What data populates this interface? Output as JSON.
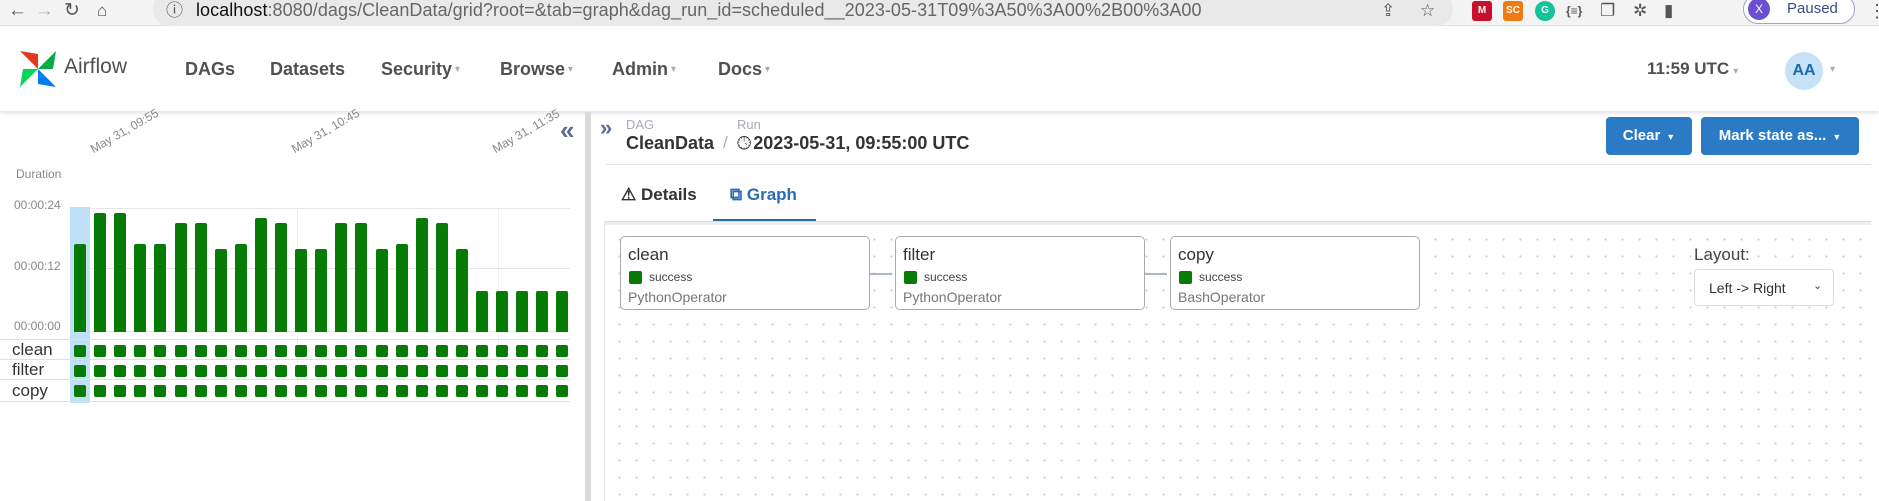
{
  "browser": {
    "url_host": "localhost",
    "url_rest": ":8080/dags/CleanData/grid?root=&tab=graph&dag_run_id=scheduled__2023-05-31T09%3A50%3A00%2B00%3A00",
    "profile_initial": "X",
    "profile_status": "Paused",
    "extensions": [
      {
        "name": "mendeley-extension",
        "text": "M",
        "color": "#c8102e"
      },
      {
        "name": "sc-extension",
        "text": "SC",
        "color": "#f07b12"
      },
      {
        "name": "grammarly-extension",
        "text": "G",
        "color": "#15c39a"
      }
    ]
  },
  "app": {
    "logo_text": "Airflow",
    "menu": [
      {
        "label": "DAGs",
        "dropdown": false
      },
      {
        "label": "Datasets",
        "dropdown": false
      },
      {
        "label": "Security",
        "dropdown": true
      },
      {
        "label": "Browse",
        "dropdown": true
      },
      {
        "label": "Admin",
        "dropdown": true
      },
      {
        "label": "Docs",
        "dropdown": true
      }
    ],
    "clock": "11:59 UTC",
    "user_initials": "AA"
  },
  "grid": {
    "duration_label": "Duration",
    "y_ticks": [
      "00:00:24",
      "00:00:12",
      "00:00:00"
    ],
    "date_labels": [
      "May 31, 09:55",
      "May 31, 10:45",
      "May 31, 11:35"
    ],
    "tasks": [
      "clean",
      "filter",
      "copy"
    ],
    "run_state": "success"
  },
  "chart_data": {
    "type": "bar",
    "title": "",
    "ylabel": "Duration",
    "ylim_seconds": [
      0,
      24
    ],
    "values_seconds": [
      17,
      23,
      23,
      17,
      17,
      21,
      21,
      16,
      17,
      22,
      21,
      16,
      16,
      21,
      21,
      16,
      17,
      22,
      21,
      16,
      8,
      8,
      8,
      8,
      8
    ],
    "selected_index": 0,
    "color": "#067b06"
  },
  "details": {
    "dag_label": "DAG",
    "dag_id": "CleanData",
    "run_label": "Run",
    "run_date": "2023-05-31, 09:55:00 UTC",
    "clear_button": "Clear",
    "mark_state_button": "Mark state as...",
    "tabs": [
      {
        "label": "Details",
        "icon": "warning-icon",
        "active": false
      },
      {
        "label": "Graph",
        "icon": "graph-icon",
        "active": true
      }
    ],
    "nodes": [
      {
        "title": "clean",
        "state": "success",
        "operator": "PythonOperator"
      },
      {
        "title": "filter",
        "state": "success",
        "operator": "PythonOperator"
      },
      {
        "title": "copy",
        "state": "success",
        "operator": "BashOperator"
      }
    ],
    "layout_label": "Layout:",
    "layout_value": "Left -> Right"
  },
  "colors": {
    "success": "#067b06",
    "primary_button": "#2b7ac5",
    "active_tab": "#2b6cb0"
  }
}
